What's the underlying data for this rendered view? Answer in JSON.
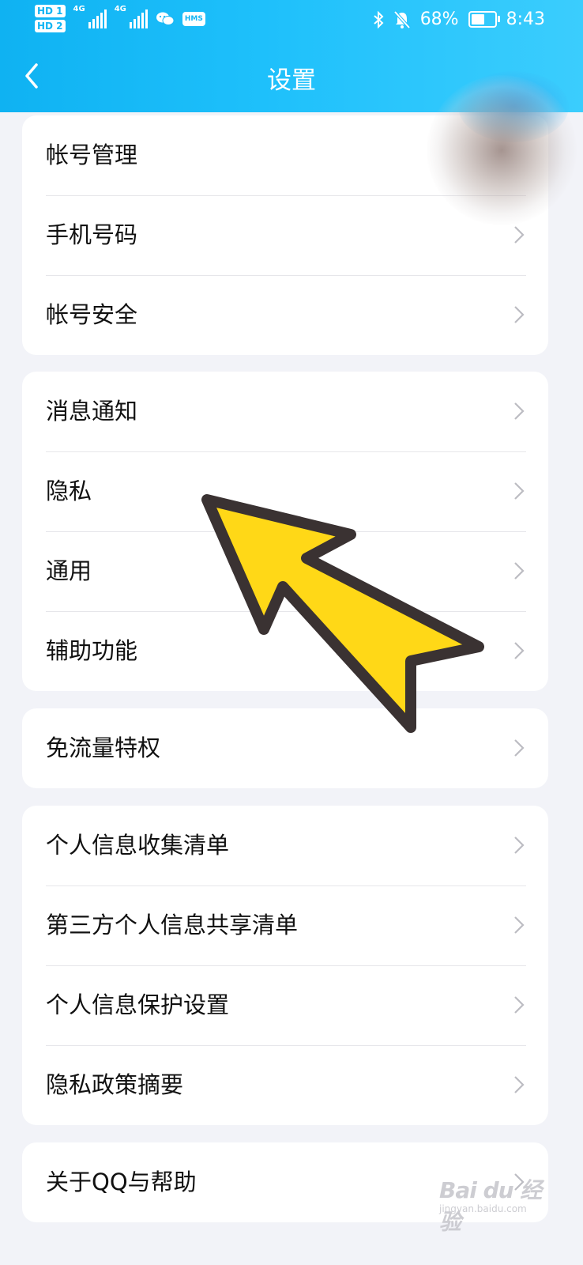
{
  "status_bar": {
    "sim1": "HD 1",
    "sim2": "HD 2",
    "net1": "4G",
    "net2": "4G",
    "hms": "HMS",
    "battery": "68%",
    "battery_level": 0.68,
    "time": "8:43"
  },
  "header": {
    "title": "设置"
  },
  "groups": [
    {
      "items": [
        {
          "label": "帐号管理"
        },
        {
          "label": "手机号码"
        },
        {
          "label": "帐号安全"
        }
      ]
    },
    {
      "items": [
        {
          "label": "消息通知"
        },
        {
          "label": "隐私"
        },
        {
          "label": "通用"
        },
        {
          "label": "辅助功能"
        }
      ]
    },
    {
      "items": [
        {
          "label": "免流量特权"
        }
      ]
    },
    {
      "items": [
        {
          "label": "个人信息收集清单"
        },
        {
          "label": "第三方个人信息共享清单"
        },
        {
          "label": "个人信息保护设置"
        },
        {
          "label": "隐私政策摘要"
        }
      ]
    },
    {
      "items": [
        {
          "label": "关于QQ与帮助"
        }
      ]
    }
  ],
  "watermark": {
    "text": "Bai du 经验",
    "sub": "jingyan.baidu.com"
  },
  "colors": {
    "header": "#1ec0fb",
    "arrow_fill": "#ffd817",
    "arrow_stroke": "#3a3232"
  }
}
